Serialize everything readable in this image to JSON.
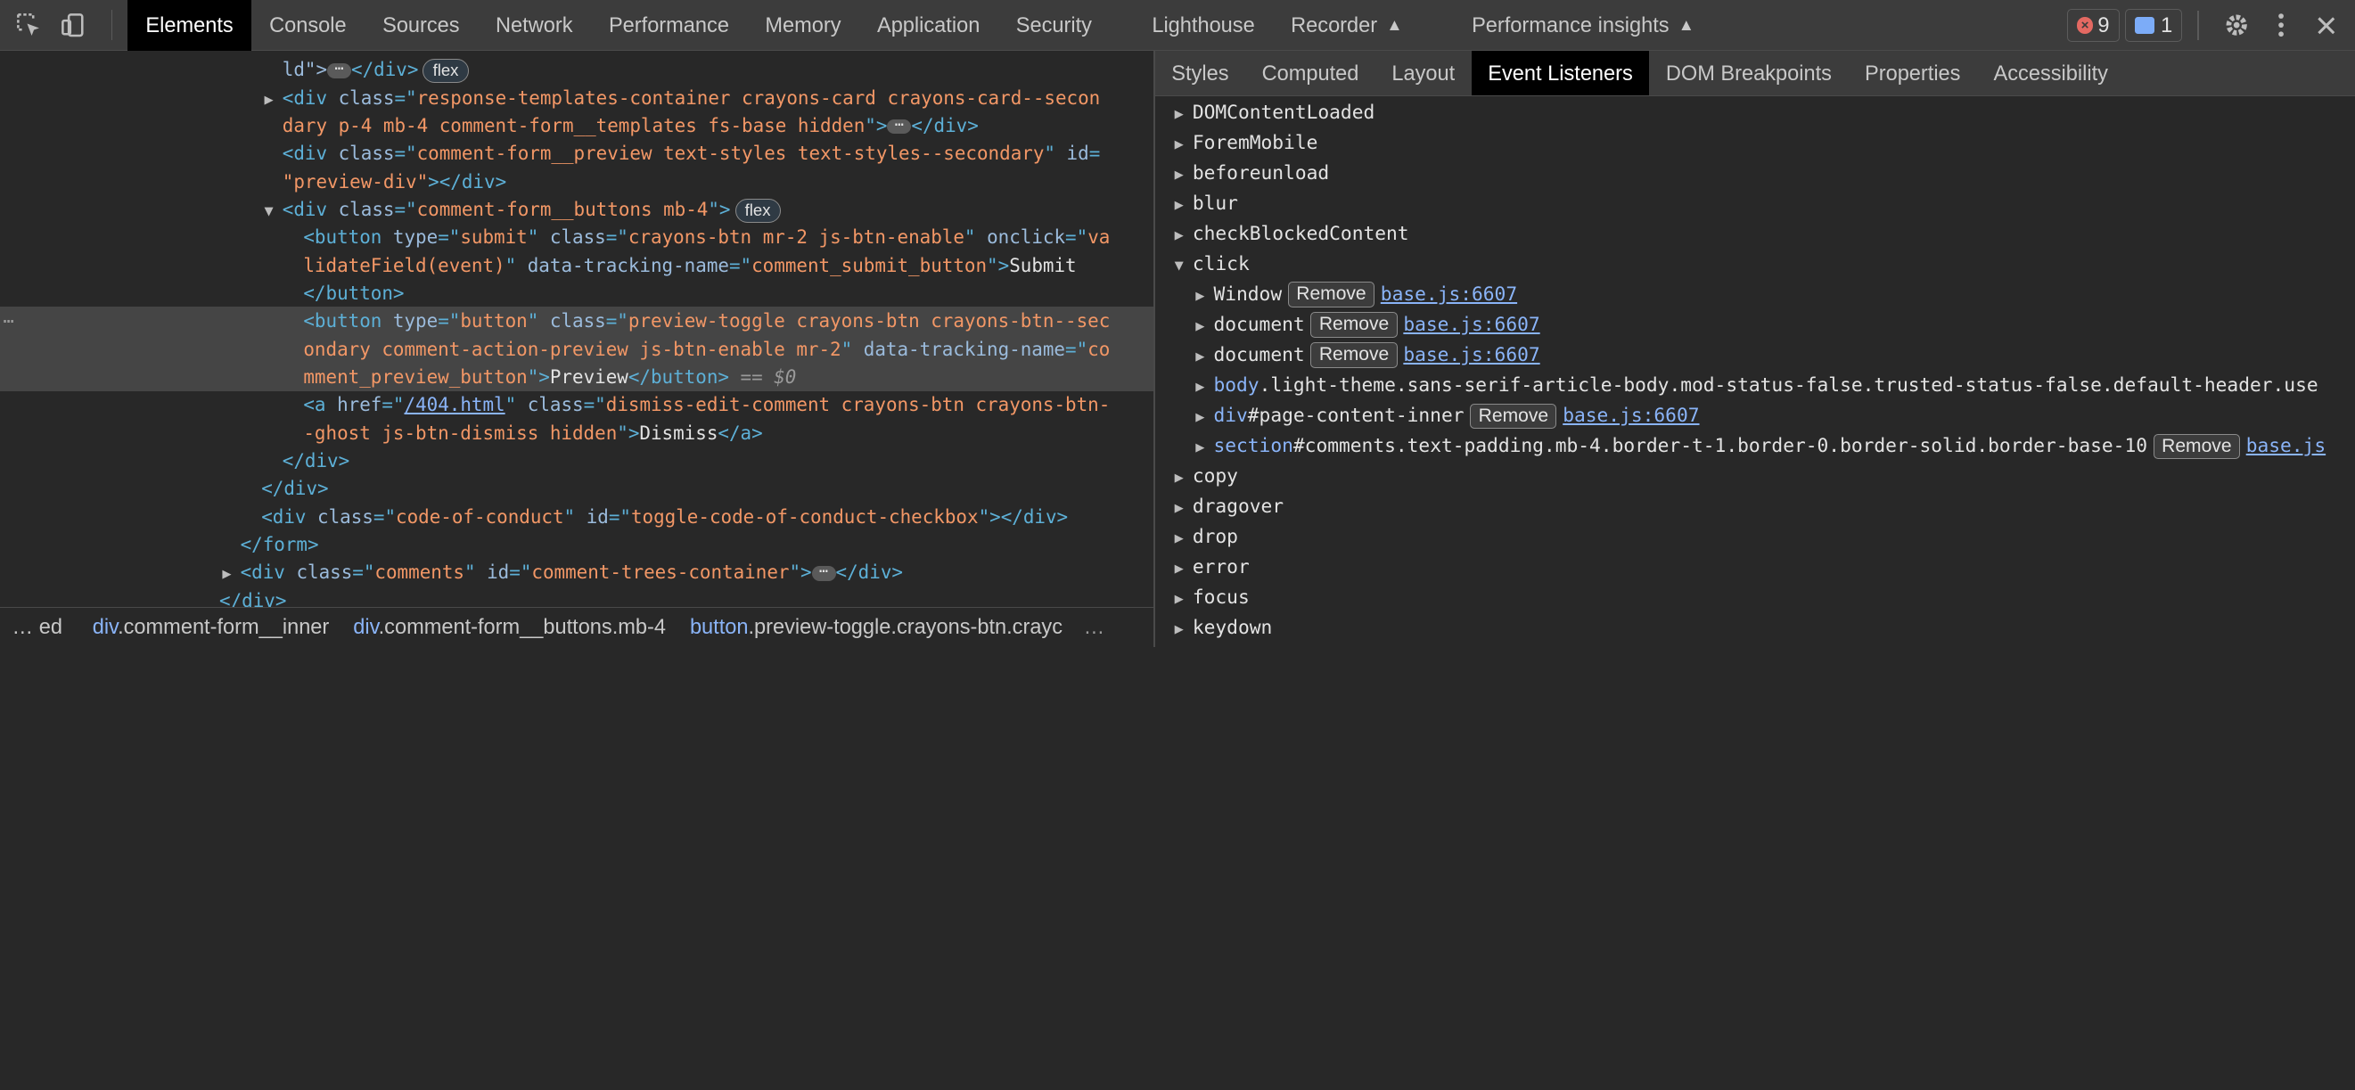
{
  "toolbar": {
    "tabs": [
      "Elements",
      "Console",
      "Sources",
      "Network",
      "Performance",
      "Memory",
      "Application",
      "Security",
      "Lighthouse",
      "Recorder",
      "Performance insights"
    ],
    "error_count": "9",
    "message_count": "1"
  },
  "dom_lines": [
    {
      "indent": 188,
      "parts": [
        [
          "at",
          "ld\">"
        ],
        [
          "ell",
          "⋯"
        ],
        [
          "tg",
          "</div>"
        ],
        [
          "pill",
          "flex"
        ]
      ]
    },
    {
      "indent": 188,
      "tri": "▶",
      "parts": [
        [
          "tg",
          "<div "
        ],
        [
          "at",
          "class"
        ],
        [
          "tg",
          "=\""
        ],
        [
          "av",
          "response-templates-container crayons-card crayons-card--secon"
        ]
      ]
    },
    {
      "indent": 188,
      "parts": [
        [
          "av",
          "dary p-4 mb-4 comment-form__templates fs-base hidden"
        ],
        [
          "tg",
          "\">"
        ],
        [
          "ell",
          "⋯"
        ],
        [
          "tg",
          "</div>"
        ]
      ]
    },
    {
      "indent": 188,
      "parts": [
        [
          "tg",
          "<div "
        ],
        [
          "at",
          "class"
        ],
        [
          "tg",
          "=\""
        ],
        [
          "av",
          "comment-form__preview text-styles text-styles--secondary"
        ],
        [
          "tg",
          "\" "
        ],
        [
          "at",
          "id"
        ],
        [
          "tg",
          "="
        ]
      ]
    },
    {
      "indent": 188,
      "parts": [
        [
          "av",
          "\"preview-div\""
        ],
        [
          "tg",
          "></div>"
        ]
      ]
    },
    {
      "indent": 188,
      "tri": "▼",
      "parts": [
        [
          "tg",
          "<div "
        ],
        [
          "at",
          "class"
        ],
        [
          "tg",
          "=\""
        ],
        [
          "av",
          "comment-form__buttons mb-4"
        ],
        [
          "tg",
          "\">"
        ],
        [
          "pill",
          "flex"
        ]
      ]
    },
    {
      "indent": 202,
      "parts": [
        [
          "tg",
          "<button "
        ],
        [
          "at",
          "type"
        ],
        [
          "tg",
          "=\""
        ],
        [
          "av",
          "submit"
        ],
        [
          "tg",
          "\" "
        ],
        [
          "at",
          "class"
        ],
        [
          "tg",
          "=\""
        ],
        [
          "av",
          "crayons-btn mr-2 js-btn-enable"
        ],
        [
          "tg",
          "\" "
        ],
        [
          "at",
          "onclick"
        ],
        [
          "tg",
          "=\""
        ],
        [
          "av",
          "va"
        ]
      ]
    },
    {
      "indent": 202,
      "parts": [
        [
          "av",
          "lidateField(event)"
        ],
        [
          "tg",
          "\" "
        ],
        [
          "at",
          "data-tracking-name"
        ],
        [
          "tg",
          "=\""
        ],
        [
          "av",
          "comment_submit_button"
        ],
        [
          "tg",
          "\">"
        ],
        [
          "tx",
          "Submit"
        ]
      ]
    },
    {
      "indent": 202,
      "parts": [
        [
          "tg",
          "</button>"
        ]
      ]
    },
    {
      "indent": 202,
      "sel": true,
      "parts": [
        [
          "tg",
          "<button "
        ],
        [
          "at",
          "type"
        ],
        [
          "tg",
          "=\""
        ],
        [
          "av",
          "button"
        ],
        [
          "tg",
          "\" "
        ],
        [
          "at",
          "class"
        ],
        [
          "tg",
          "=\""
        ],
        [
          "av",
          "preview-toggle crayons-btn crayons-btn--sec"
        ]
      ]
    },
    {
      "indent": 202,
      "sel": true,
      "parts": [
        [
          "av",
          "ondary comment-action-preview js-btn-enable mr-2"
        ],
        [
          "tg",
          "\" "
        ],
        [
          "at",
          "data-tracking-name"
        ],
        [
          "tg",
          "=\""
        ],
        [
          "av",
          "co"
        ]
      ]
    },
    {
      "indent": 202,
      "sel": true,
      "parts": [
        [
          "av",
          "mment_preview_button"
        ],
        [
          "tg",
          "\">"
        ],
        [
          "tx",
          "Preview"
        ],
        [
          "tg",
          "</button>"
        ],
        [
          "dim",
          " == $0"
        ]
      ]
    },
    {
      "indent": 202,
      "parts": [
        [
          "tg",
          "<a "
        ],
        [
          "at",
          "href"
        ],
        [
          "tg",
          "=\""
        ],
        [
          "lk",
          "/404.html"
        ],
        [
          "tg",
          "\" "
        ],
        [
          "at",
          "class"
        ],
        [
          "tg",
          "=\""
        ],
        [
          "av",
          "dismiss-edit-comment crayons-btn crayons-btn-"
        ]
      ]
    },
    {
      "indent": 202,
      "parts": [
        [
          "av",
          "-ghost js-btn-dismiss hidden"
        ],
        [
          "tg",
          "\">"
        ],
        [
          "tx",
          "Dismiss"
        ],
        [
          "tg",
          "</a>"
        ]
      ]
    },
    {
      "indent": 188,
      "parts": [
        [
          "tg",
          "</div>"
        ]
      ]
    },
    {
      "indent": 174,
      "parts": [
        [
          "tg",
          "</div>"
        ]
      ]
    },
    {
      "indent": 174,
      "parts": [
        [
          "tg",
          "<div "
        ],
        [
          "at",
          "class"
        ],
        [
          "tg",
          "=\""
        ],
        [
          "av",
          "code-of-conduct"
        ],
        [
          "tg",
          "\" "
        ],
        [
          "at",
          "id"
        ],
        [
          "tg",
          "=\""
        ],
        [
          "av",
          "toggle-code-of-conduct-checkbox"
        ],
        [
          "tg",
          "\"></div>"
        ]
      ]
    },
    {
      "indent": 160,
      "parts": [
        [
          "tg",
          "</form>"
        ]
      ]
    },
    {
      "indent": 160,
      "tri": "▶",
      "parts": [
        [
          "tg",
          "<div "
        ],
        [
          "at",
          "class"
        ],
        [
          "tg",
          "=\""
        ],
        [
          "av",
          "comments"
        ],
        [
          "tg",
          "\" "
        ],
        [
          "at",
          "id"
        ],
        [
          "tg",
          "=\""
        ],
        [
          "av",
          "comment-trees-container"
        ],
        [
          "tg",
          "\">"
        ],
        [
          "ell",
          "⋯"
        ],
        [
          "tg",
          "</div>"
        ]
      ]
    },
    {
      "indent": 146,
      "parts": [
        [
          "tg",
          "</div>"
        ]
      ]
    }
  ],
  "breadcrumbs": {
    "more": "…",
    "first": "ed",
    "items": [
      {
        "tag": "div",
        "cls": ".comment-form__inner"
      },
      {
        "tag": "div",
        "cls": ".comment-form__buttons.mb-4"
      },
      {
        "tag": "button",
        "cls": ".preview-toggle.crayons-btn.crayc"
      }
    ],
    "trailing": "…"
  },
  "side_tabs": [
    "Styles",
    "Computed",
    "Layout",
    "Event Listeners",
    "DOM Breakpoints",
    "Properties",
    "Accessibility"
  ],
  "listeners": [
    {
      "name": "DOMContentLoaded",
      "expanded": false
    },
    {
      "name": "ForemMobile",
      "expanded": false
    },
    {
      "name": "beforeunload",
      "expanded": false
    },
    {
      "name": "blur",
      "expanded": false
    },
    {
      "name": "checkBlockedContent",
      "expanded": false
    },
    {
      "name": "click",
      "expanded": true,
      "children": [
        {
          "tag": "Window",
          "cls": "",
          "remove": "Remove",
          "src": "base.js:6607"
        },
        {
          "tag": "document",
          "cls": "",
          "remove": "Remove",
          "src": "base.js:6607"
        },
        {
          "tag": "document",
          "cls": "",
          "remove": "Remove",
          "src": "base.js:6607"
        },
        {
          "tag": "body",
          "cls": ".light-theme.sans-serif-article-body.mod-status-false.trusted-status-false.default-header.use",
          "remove": "",
          "src": ""
        },
        {
          "tag": "div",
          "cls": "#page-content-inner",
          "remove": "Remove",
          "src": "base.js:6607"
        },
        {
          "tag": "section",
          "cls": "#comments.text-padding.mb-4.border-t-1.border-0.border-solid.border-base-10",
          "remove": "Remove",
          "src": "base.js"
        }
      ]
    },
    {
      "name": "copy",
      "expanded": false
    },
    {
      "name": "dragover",
      "expanded": false
    },
    {
      "name": "drop",
      "expanded": false
    },
    {
      "name": "error",
      "expanded": false
    },
    {
      "name": "focus",
      "expanded": false
    },
    {
      "name": "keydown",
      "expanded": false
    }
  ],
  "colors": {
    "accent": "#8ab4f8",
    "error": "#e46962",
    "panel": "#282828",
    "toolbar": "#3c3c3c"
  }
}
